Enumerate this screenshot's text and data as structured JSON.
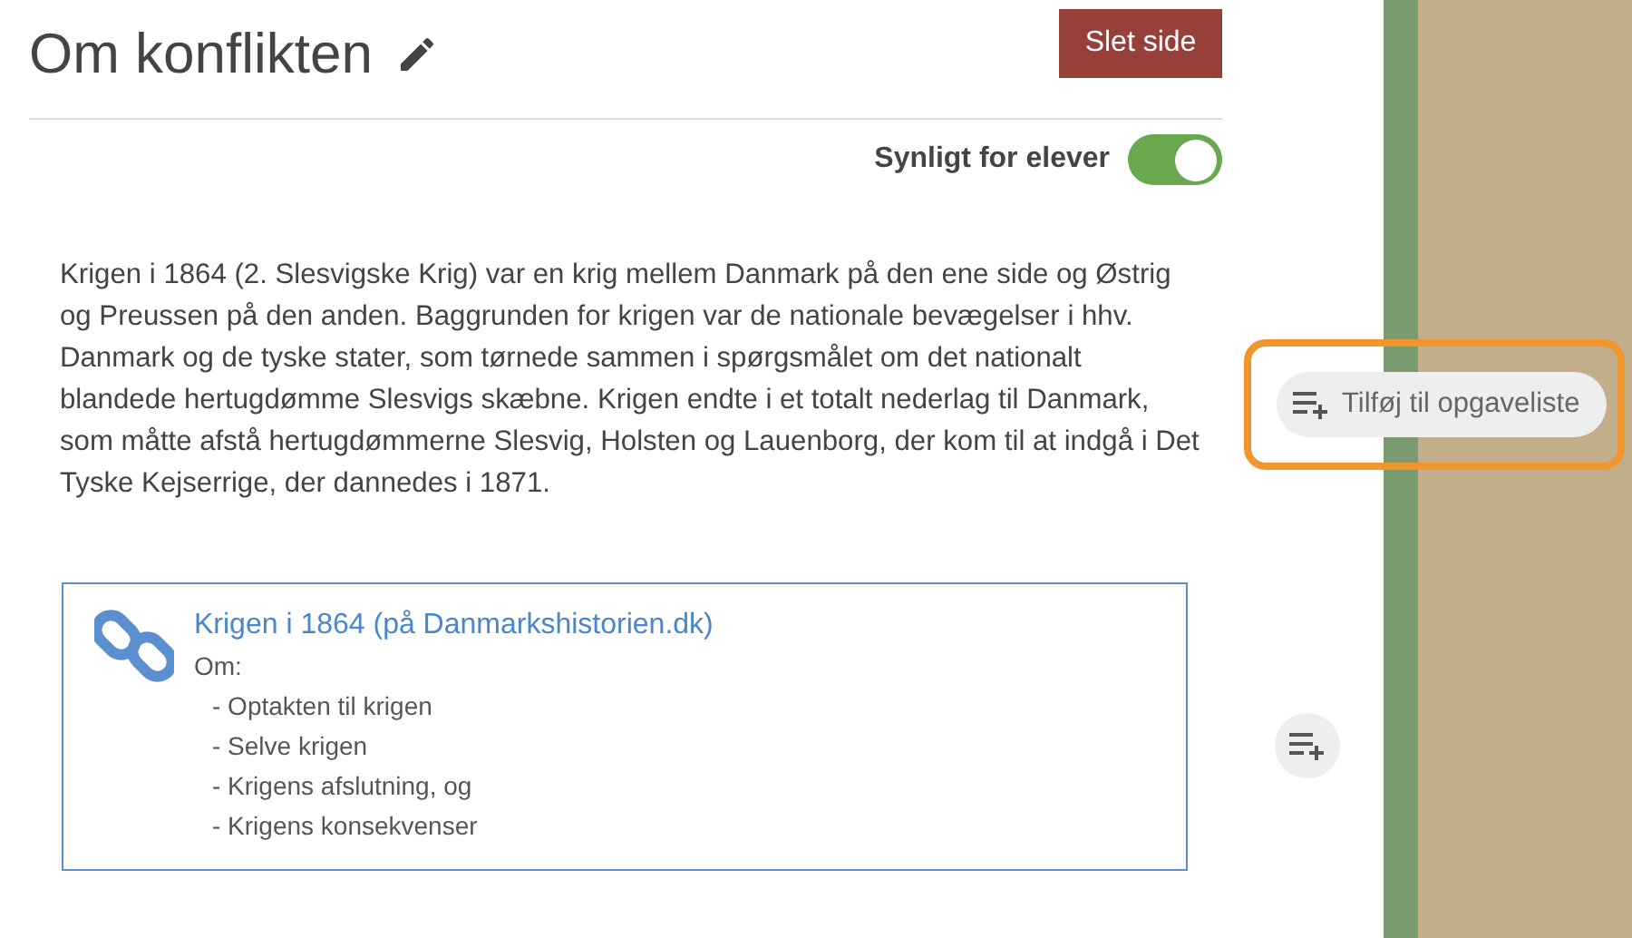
{
  "page": {
    "title": "Om konflikten",
    "delete_button": "Slet side",
    "visibility": {
      "label": "Synligt for elever",
      "on": true
    }
  },
  "body_text": "Krigen i 1864 (2. Slesvigske Krig) var en krig mellem Danmark på den ene side og Østrig og Preussen på den anden. Baggrunden for krigen var de nationale bevægelser i hhv. Danmark og de tyske stater, som tørnede sammen i spørgsmålet om det nationalt blandede hertugdømme Slesvigs skæbne. Krigen endte i et totalt nederlag til Danmark, som måtte afstå hertugdømmerne Slesvig, Holsten og Lauenborg, der kom til at indgå i Det Tyske Kejserrige, der dannedes i 1871.",
  "link_card": {
    "title": "Krigen i 1864 (på Danmarkshistorien.dk)",
    "intro": "Om:",
    "items": [
      "- Optakten til krigen",
      "- Selve krigen",
      "- Krigens afslutning, og",
      "- Krigens konsekvenser"
    ]
  },
  "add_to_list_button": {
    "label": "Tilføj til opgaveliste",
    "highlighted": true
  }
}
